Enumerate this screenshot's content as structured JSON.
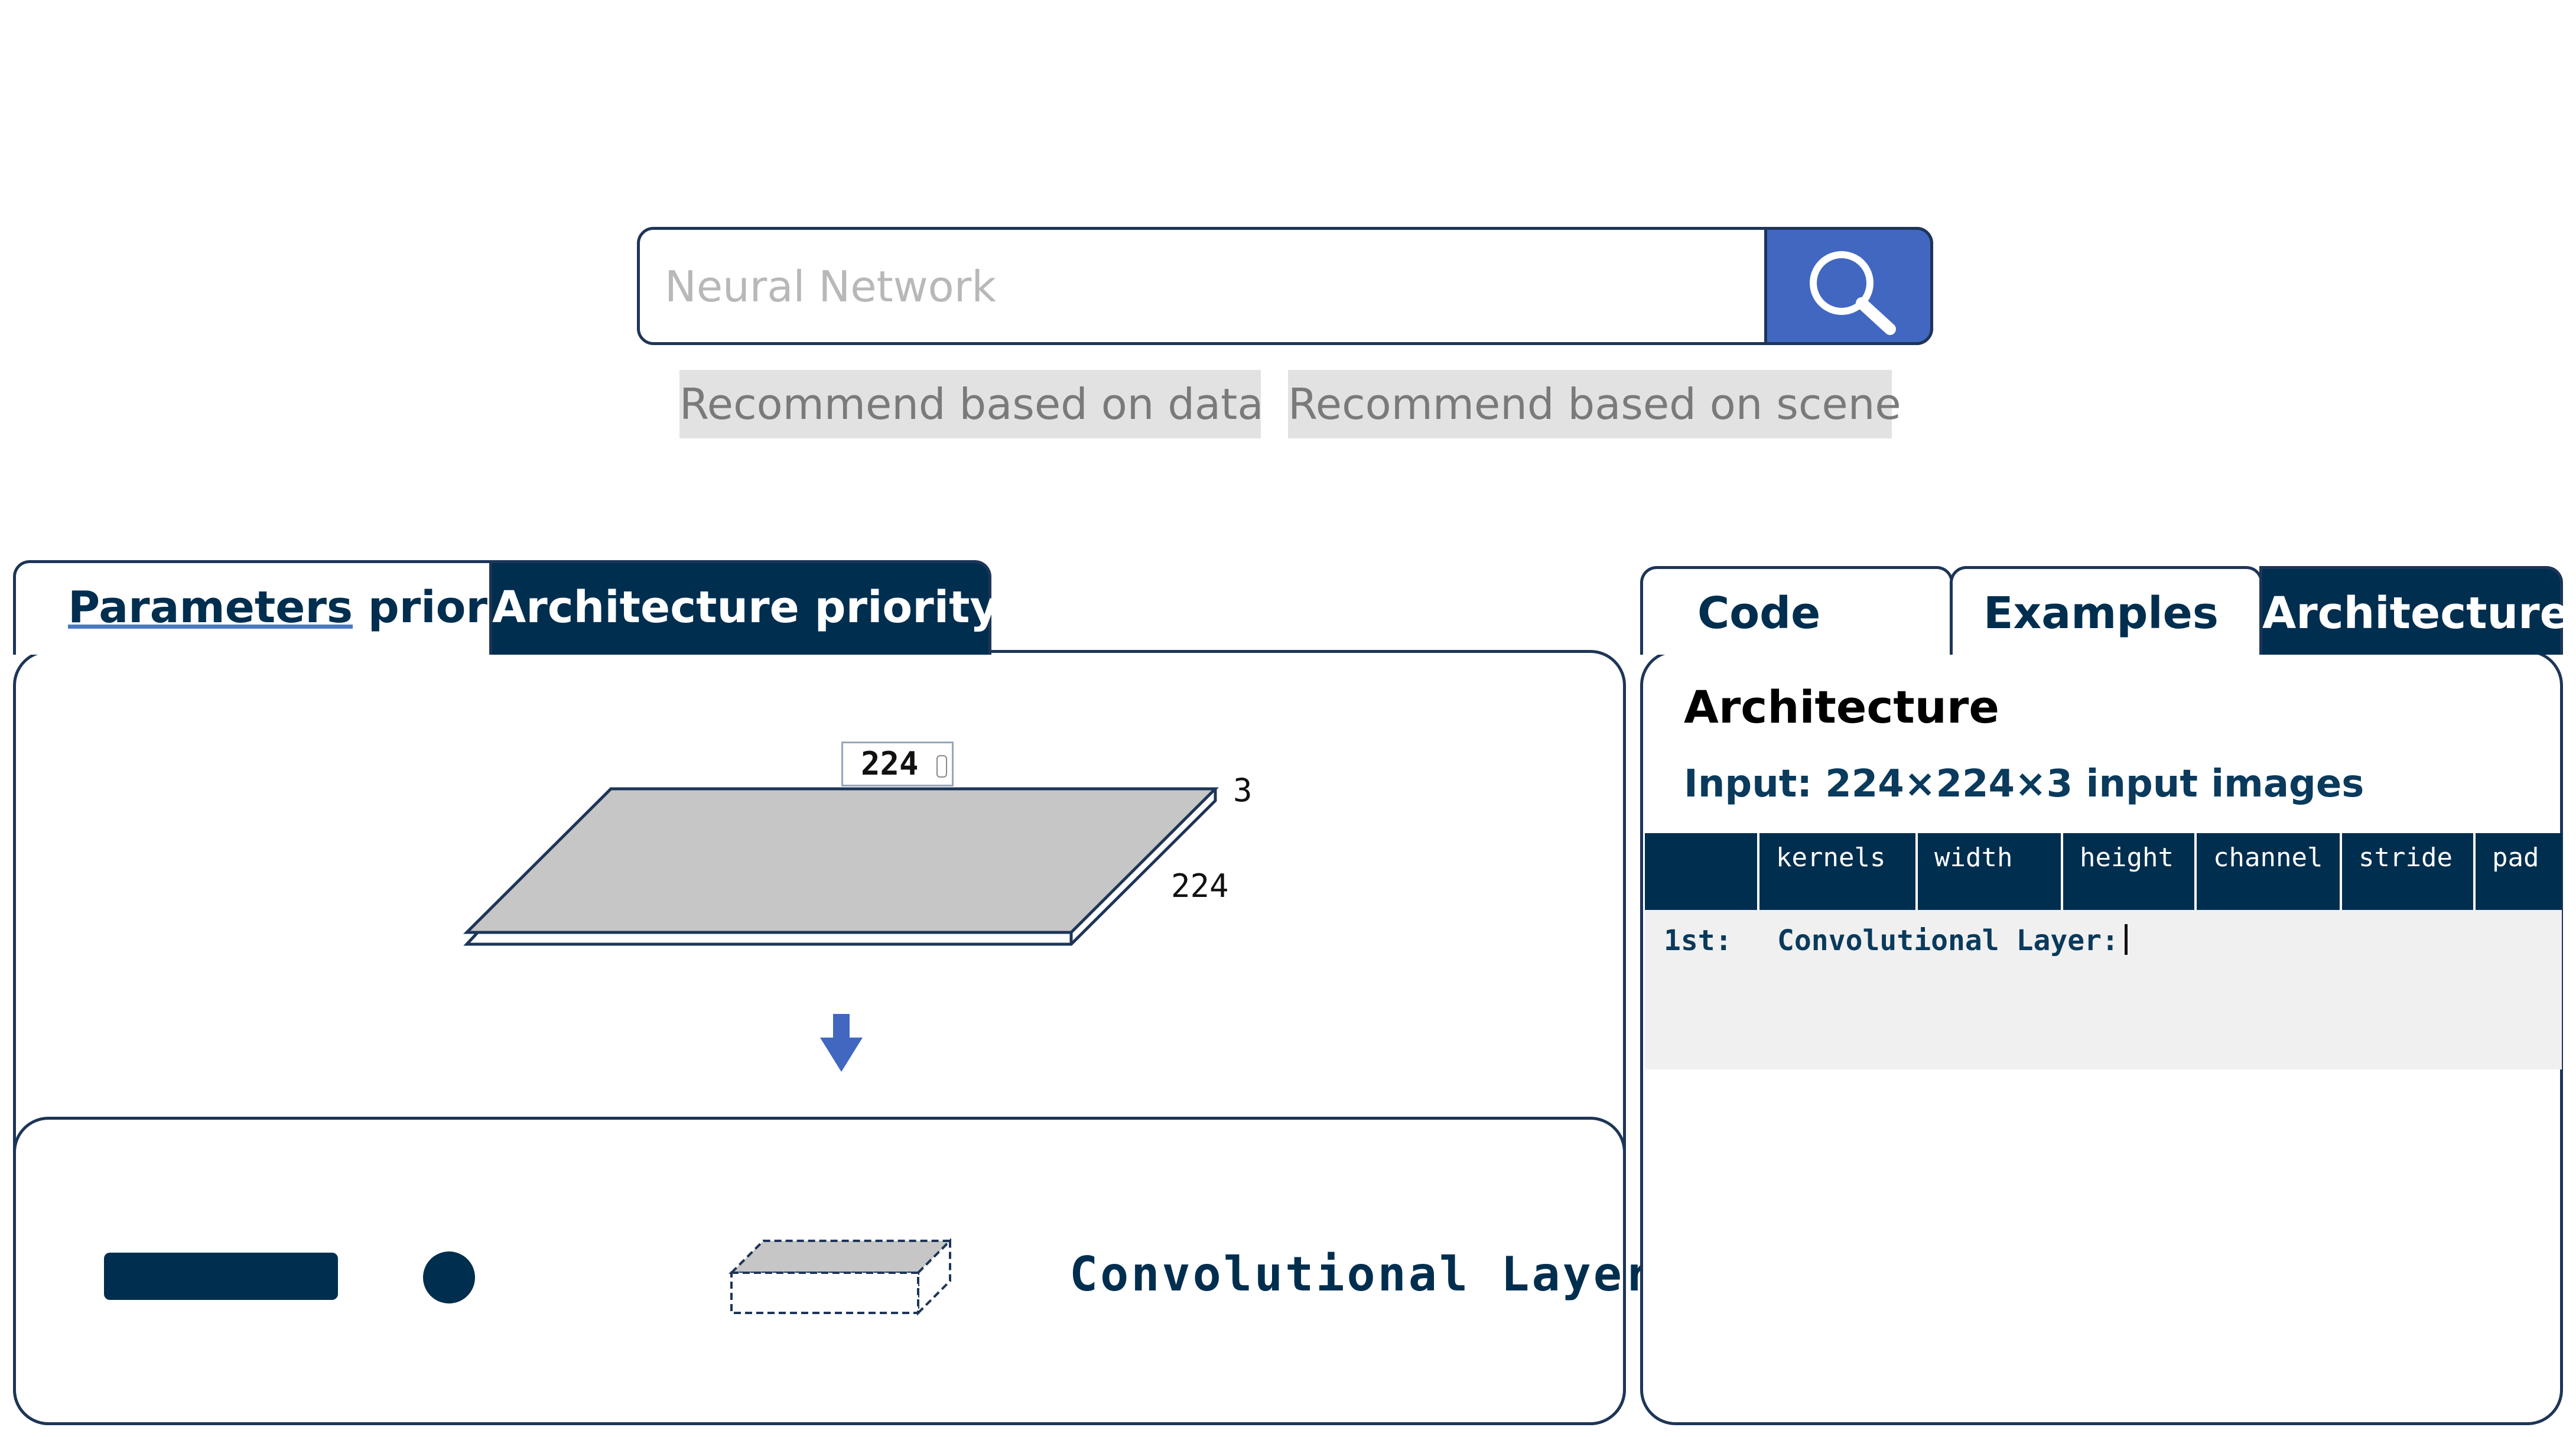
{
  "search": {
    "placeholder": "Neural Network",
    "value": "",
    "icon": "search-icon",
    "button_color": "#4167c1"
  },
  "recommend": {
    "data_label": "Recommend based on data",
    "scene_label": "Recommend based on scene"
  },
  "left_tabs": {
    "parameters": {
      "underlined": "Parameters",
      "rest": " priority"
    },
    "architecture": "Architecture priority",
    "active": "architecture"
  },
  "input_layer": {
    "width_value": "224",
    "channels_label": "3",
    "height_label": "224"
  },
  "layer_palette": {
    "selected_label": "Convolutional Layer"
  },
  "right_tabs": {
    "code": "Code",
    "examples": "Examples",
    "architecture": "Architecture",
    "active": "architecture"
  },
  "architecture": {
    "title": "Architecture",
    "input_line": "Input: 224×224×3 input images",
    "table": {
      "columns": [
        "kernels",
        "width",
        "height",
        "channel",
        "stride",
        "pad"
      ],
      "rows": [
        {
          "index": "1st:",
          "text": "Convolutional Layer:"
        }
      ]
    }
  },
  "colors": {
    "navy": "#002e4f",
    "border": "#1d3557",
    "accent_blue": "#4167c1",
    "plane_gray": "#c8c8c8"
  }
}
